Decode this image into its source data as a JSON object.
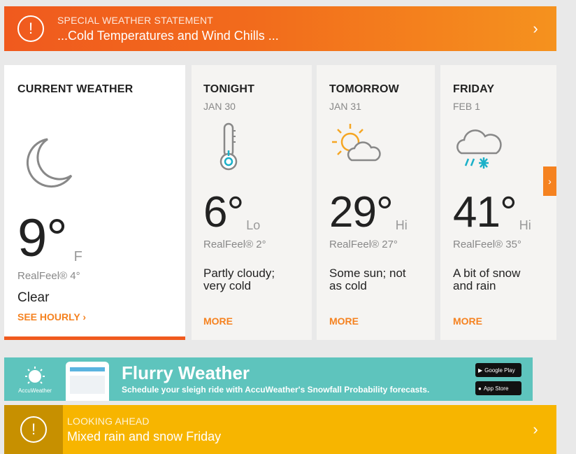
{
  "alert_top": {
    "label": "SPECIAL WEATHER STATEMENT",
    "title": "...Cold Temperatures and Wind Chills ...",
    "color": "#f05a1e"
  },
  "current": {
    "title": "CURRENT WEATHER",
    "icon": "moon-icon",
    "temp": "9°",
    "unit": "F",
    "realfeel": "RealFeel® 4°",
    "condition": "Clear",
    "see_hourly": "SEE HOURLY"
  },
  "forecast": [
    {
      "title": "TONIGHT",
      "date": "JAN 30",
      "icon": "thermometer-cold-icon",
      "temp": "6°",
      "qualifier": "Lo",
      "realfeel": "RealFeel® 2°",
      "phrase": "Partly cloudy; very cold",
      "more": "MORE"
    },
    {
      "title": "TOMORROW",
      "date": "JAN 31",
      "icon": "sun-cloud-icon",
      "temp": "29°",
      "qualifier": "Hi",
      "realfeel": "RealFeel® 27°",
      "phrase": "Some sun; not as cold",
      "more": "MORE"
    },
    {
      "title": "FRIDAY",
      "date": "FEB 1",
      "icon": "snow-rain-cloud-icon",
      "temp": "41°",
      "qualifier": "Hi",
      "realfeel": "RealFeel® 35°",
      "phrase": "A bit of snow and rain",
      "more": "MORE"
    }
  ],
  "ad": {
    "brand": "AccuWeather",
    "headline": "Flurry Weather",
    "tagline": "Schedule your sleigh ride with AccuWeather's Snowfall Probability forecasts.",
    "store_google": "Google Play",
    "store_apple": "App Store",
    "color": "#5ec4bd"
  },
  "alert_bottom": {
    "label": "LOOKING AHEAD",
    "title": "Mixed rain and snow Friday",
    "color": "#f7b500"
  },
  "colors": {
    "accent": "#f58220"
  }
}
